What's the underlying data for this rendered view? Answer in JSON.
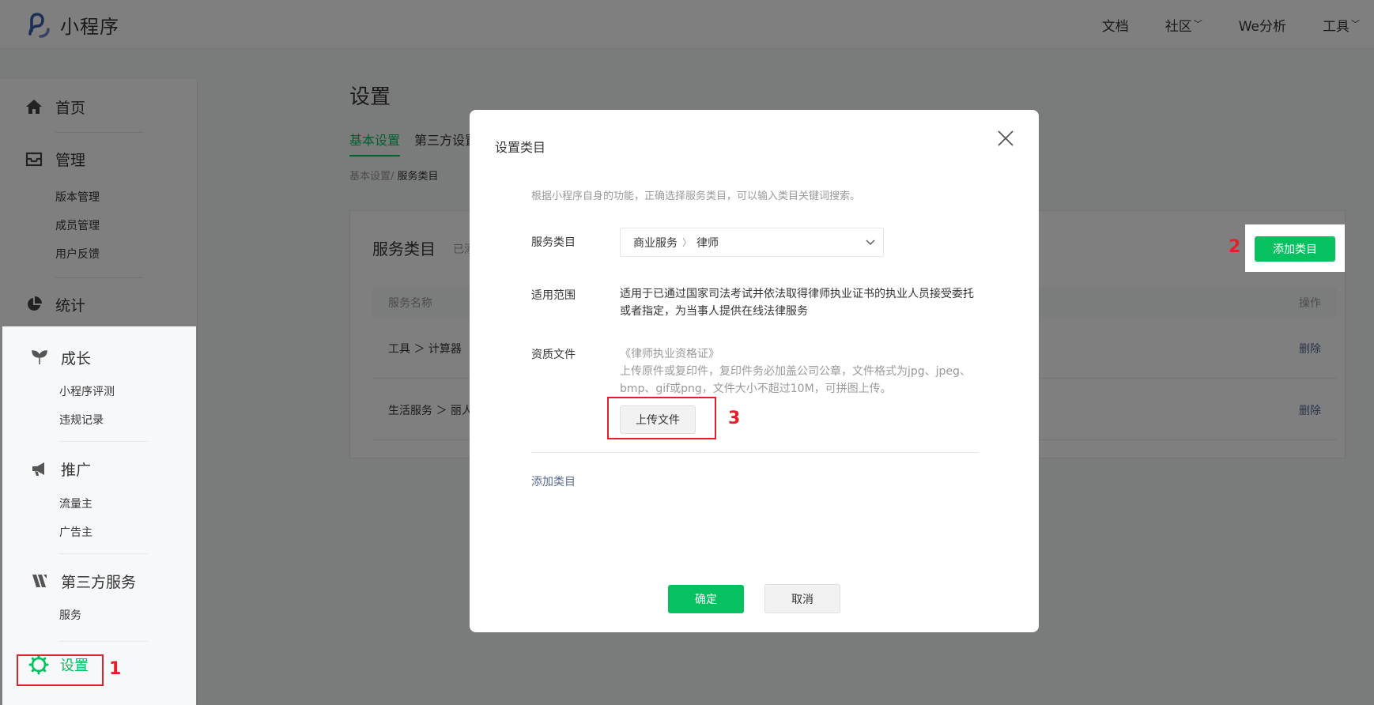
{
  "header": {
    "logo_text": "小程序",
    "nav": [
      {
        "label": "文档",
        "dropdown": false
      },
      {
        "label": "社区",
        "dropdown": true
      },
      {
        "label": "We分析",
        "dropdown": false
      },
      {
        "label": "工具",
        "dropdown": true
      }
    ]
  },
  "sidebar": {
    "home": "首页",
    "manage": "管理",
    "manage_items": [
      "版本管理",
      "成员管理",
      "用户反馈"
    ],
    "stats": "统计",
    "growth": "成长",
    "growth_items": [
      "小程序评测",
      "违规记录"
    ],
    "promote": "推广",
    "promote_items": [
      "流量主",
      "广告主"
    ],
    "thirdparty": "第三方服务",
    "thirdparty_items": [
      "服务"
    ],
    "settings": "设置"
  },
  "main": {
    "title": "设置",
    "tabs": [
      "基本设置",
      "第三方设置"
    ],
    "breadcrumb_parent": "基本设置/",
    "breadcrumb_current": "服务类目",
    "card_title": "服务类目",
    "card_sub": "已添",
    "col_name": "服务名称",
    "col_op": "操作",
    "rows": [
      {
        "name": "工具 ＞ 计算器",
        "op": "删除"
      },
      {
        "name": "生活服务 ＞ 丽人",
        "op": "删除"
      }
    ],
    "add_button": "添加类目"
  },
  "modal": {
    "title": "设置类目",
    "hint": "根据小程序自身的功能，正确选择服务类目，可以输入类目关键词搜索。",
    "label_category": "服务类目",
    "select_level1": "商业服务",
    "select_level2": "律师",
    "label_scope": "适用范围",
    "scope_text": "适用于已通过国家司法考试并依法取得律师执业证书的执业人员接受委托或者指定，为当事人提供在线法律服务",
    "label_docs": "资质文件",
    "doc_title": "《律师执业资格证》",
    "doc_desc": "上传原件或复印件，复印件务必加盖公司公章，文件格式为jpg、jpeg、bmp、gif或png，文件大小不超过10M，可拼图上传。",
    "upload_button": "上传文件",
    "add_category_link": "添加类目",
    "ok_button": "确定",
    "cancel_button": "取消"
  },
  "annotations": {
    "n1": "1",
    "n2": "2",
    "n3": "3"
  },
  "colors": {
    "brand_green": "#07c160",
    "annotation_red": "#e2202c",
    "link_blue": "#576b95"
  }
}
